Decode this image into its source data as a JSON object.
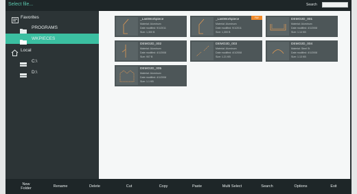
{
  "window": {
    "title": "Select file..."
  },
  "search": {
    "label": "Search",
    "value": "",
    "placeholder": ""
  },
  "sidebar": {
    "favorites": {
      "label": "Favorites",
      "icon": "favorites-icon"
    },
    "items": [
      {
        "label": "PROGRAMS",
        "icon": "folder-icon",
        "selected": false
      },
      {
        "label": "WKPIECES",
        "icon": "folder-icon",
        "selected": true
      }
    ],
    "local": {
      "label": "Local",
      "icon": "home-icon"
    },
    "drives": [
      {
        "label": "C:\\",
        "icon": "drive-icon"
      },
      {
        "label": "D:\\",
        "icon": "drive-icon"
      }
    ]
  },
  "files": [
    {
      "name": "_LastWorkpiece",
      "material": "Material: Aluminum",
      "modified": "Date modified: 9/1/2011",
      "size": "Size: 1,300 B",
      "badge": ""
    },
    {
      "name": "_LastWorkpiece",
      "material": "Material: Aluminum",
      "modified": "Date modified: 9/1/2011",
      "size": "Size: 1,300 B",
      "badge": "FAV"
    },
    {
      "name": "DEMO2D_001",
      "material": "Material: Aluminum",
      "modified": "Date modified: 4/1/2008",
      "size": "Size: 1.14 KB",
      "badge": ""
    },
    {
      "name": "DEMO2D_002",
      "material": "Material: Aluminum",
      "modified": "Date modified: 4/1/2008",
      "size": "Size: 907 B",
      "badge": ""
    },
    {
      "name": "DEMO2D_003",
      "material": "Material: Aluminum",
      "modified": "Date modified: 4/1/2008",
      "size": "Size: 1.21 KB",
      "badge": ""
    },
    {
      "name": "DEMO2D_004",
      "material": "Material: Steel St",
      "modified": "Date modified: 4/1/2008",
      "size": "Size: 1.13 KB",
      "badge": ""
    },
    {
      "name": "DEMO2D_005",
      "material": "Material: Aluminum",
      "modified": "Date modified: 4/1/2008",
      "size": "Size: 1.1 KB",
      "badge": ""
    }
  ],
  "toolbar": {
    "buttons": [
      {
        "label": "New\nFolder"
      },
      {
        "label": "Rename"
      },
      {
        "label": "Delete"
      },
      {
        "label": "Cut"
      },
      {
        "label": "Copy"
      },
      {
        "label": "Paste"
      },
      {
        "label": "Multi Select"
      },
      {
        "label": "Search"
      },
      {
        "label": "Options"
      },
      {
        "label": "Exit"
      }
    ]
  },
  "colors": {
    "accent": "#3bbfa1",
    "badge": "#f08a2a",
    "profile": "#e39a52"
  }
}
